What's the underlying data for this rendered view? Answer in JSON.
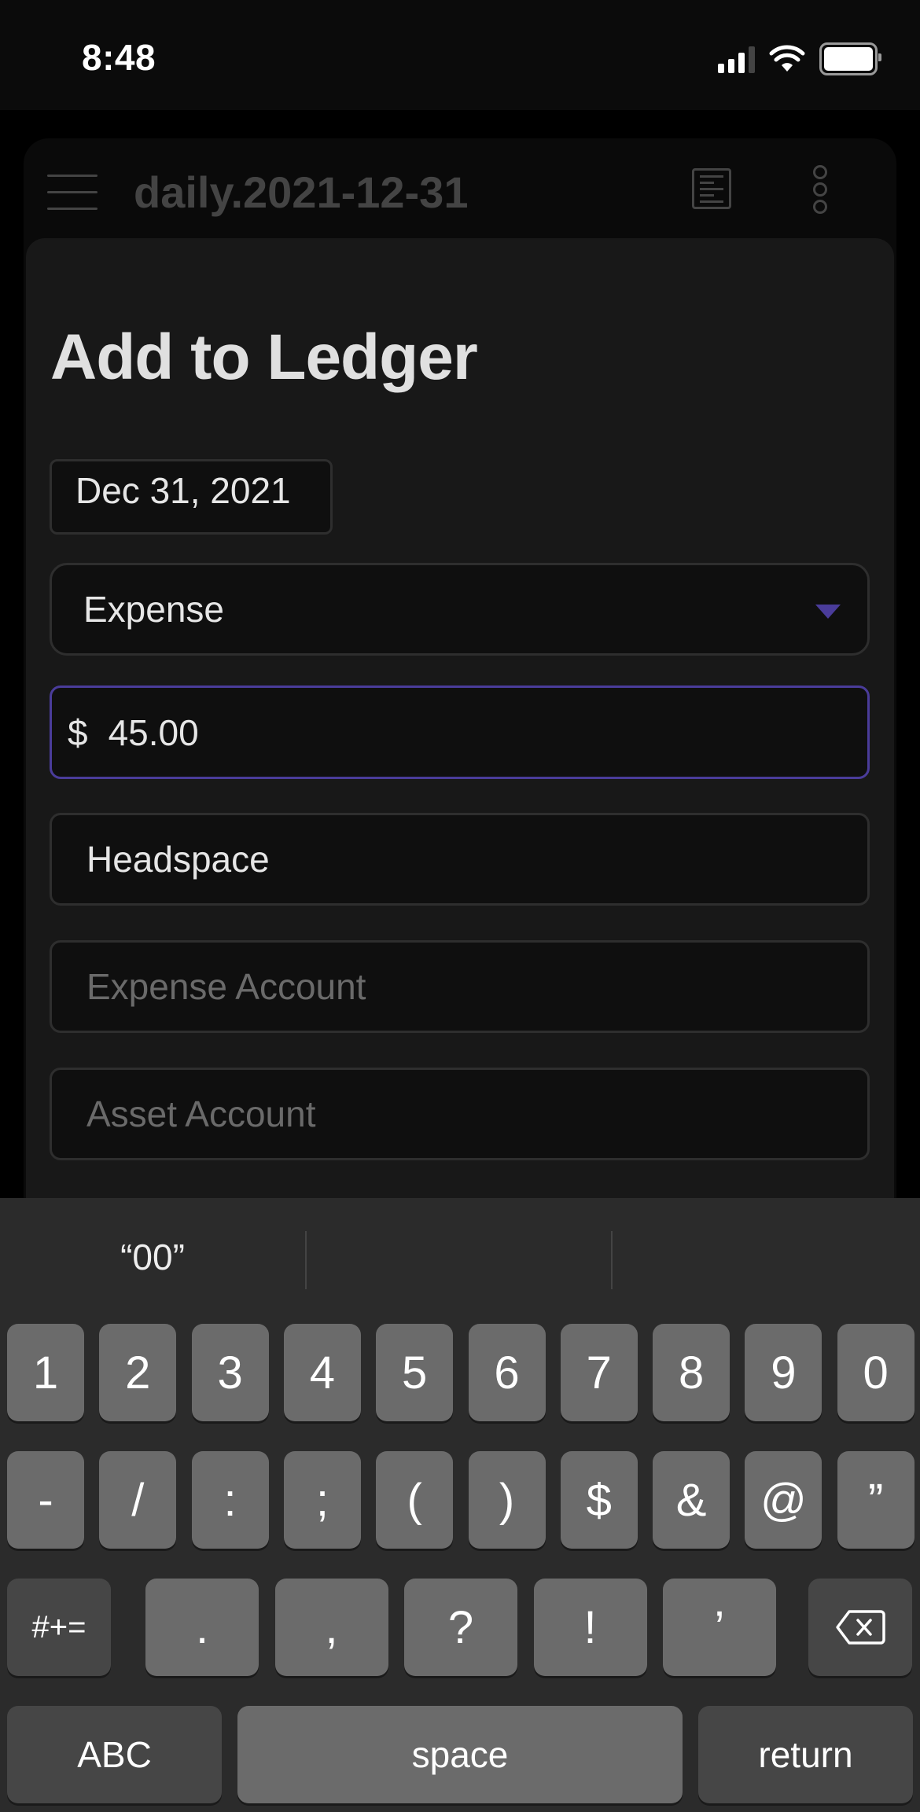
{
  "status_bar": {
    "time": "8:48",
    "icons": [
      "signal-icon",
      "wifi-icon",
      "battery-icon"
    ]
  },
  "app_header": {
    "menu_icon": "hamburger-menu-icon",
    "title": "daily.2021-12-31",
    "outline_icon": "document-outline-icon",
    "more_icon": "more-vertical-icon"
  },
  "form": {
    "title": "Add to Ledger",
    "date": "Dec 31, 2021",
    "type": {
      "selected": "Expense",
      "icon": "dropdown-arrow-icon"
    },
    "amount": {
      "currency": "$",
      "value": "45.00"
    },
    "payee": {
      "value": "Headspace"
    },
    "expense_account": {
      "value": "",
      "placeholder": "Expense Account"
    },
    "asset_account": {
      "value": "",
      "placeholder": "Asset Account"
    }
  },
  "keyboard": {
    "suggestions": [
      "“00”",
      "",
      ""
    ],
    "row1": [
      "1",
      "2",
      "3",
      "4",
      "5",
      "6",
      "7",
      "8",
      "9",
      "0"
    ],
    "row2": [
      "-",
      "/",
      ":",
      ";",
      "(",
      ")",
      "$",
      "&",
      "@",
      "”"
    ],
    "row3": {
      "shift": "#+=",
      "keys": [
        ".",
        ",",
        "?",
        "!",
        "’"
      ],
      "backspace_icon": "backspace-icon"
    },
    "row4": {
      "abc": "ABC",
      "space": "space",
      "return": "return"
    }
  },
  "colors": {
    "accent": "#4a3c9a",
    "sheet_bg": "#181818",
    "field_bg": "#0f0f0f",
    "key_bg": "#6b6b6b",
    "keyboard_bg": "#2b2b2b"
  }
}
